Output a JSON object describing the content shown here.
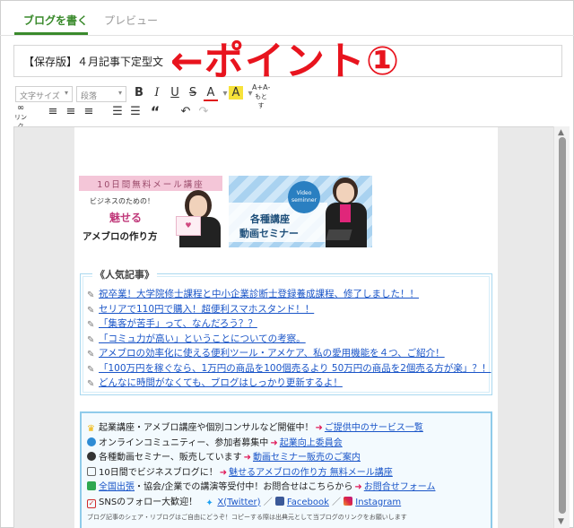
{
  "tabs": {
    "write": "ブログを書く",
    "preview": "プレビュー"
  },
  "title": {
    "value": "【保存版】４月記事下定型文"
  },
  "annotation": {
    "text": "←ポイント①"
  },
  "toolbar": {
    "font_size": "文字サイズ",
    "paragraph": "段落",
    "bold": "B",
    "italic": "I",
    "underline": "U",
    "strike": "S",
    "text_color": "A",
    "highlight": "A",
    "font_size_adjust": "A+A-",
    "font_size_adjust_sub": "もとす",
    "link": "リンク",
    "align_left": "≡",
    "align_center": "≡",
    "align_right": "≡",
    "bullet_list": "☰",
    "numbered_list": "☰",
    "quote": "“",
    "undo": "↶",
    "redo": "↷",
    "caret": "▾"
  },
  "banners": {
    "mail": {
      "top": "10日間無料メール講座",
      "line1": "ビジネスのための！",
      "line2": "魅せる",
      "line3": "アメブロの作り方",
      "card": "♥"
    },
    "video": {
      "badge": "Video seminner",
      "line1": "各種講座",
      "line2": "動画セミナー"
    }
  },
  "popular": {
    "title": "《人気記事》",
    "items": [
      "祝卒業！大学院修士課程と中小企業診断士登録養成課程、修了しました！！",
      "セリアで110円で購入！超便利スマホスタンド！！",
      "「集客が苦手」って、なんだろう？？",
      "「コミュ力が高い」ということについての考察。",
      "アメブロの効率化に使える便利ツール・アメケア、私の愛用機能を４つ、ご紹介！",
      "「100万円を稼ぐなら、1万円の商品を100個売るより 50万円の商品を2個売る方が楽」？！",
      "どんなに時間がなくても、ブログはしっかり更新するよ！"
    ]
  },
  "info": {
    "rows": [
      {
        "text": "起業講座・アメブロ講座や個別コンサルなど開催中！",
        "link": "ご提供中のサービス一覧",
        "color": "#f0b400"
      },
      {
        "text": "オンラインコミュニティー、参加者募集中",
        "link": "起業向上委員会",
        "color": "#2e8bd4"
      },
      {
        "text": "各種動画セミナー、販売しています",
        "link": "動画セミナー販売のご案内",
        "color": "#333333"
      },
      {
        "text": "10日間でビジネスブログに！",
        "link": "魅せるアメブロの作り方 無料メール講座",
        "color": "#666666"
      },
      {
        "link_first": "全国出張",
        "text": "・協会/企業での講演等受付中！お問合せはこちらから",
        "link": "お問合せフォーム",
        "color": "#2fa84f"
      }
    ],
    "sns_label": "SNSのフォロー大歓迎！",
    "sns_x": "X(Twitter)",
    "sns_sep": "／",
    "sns_fb": "Facebook",
    "sns_ig": "Instagram",
    "share_note": "ブログ記事のシェア・リブログはご自由にどうぞ！コピーする際は出典元として当ブログのリンクをお願いします",
    "arrow": "➜"
  },
  "scroll": {
    "up": "▲",
    "down": "▼"
  }
}
